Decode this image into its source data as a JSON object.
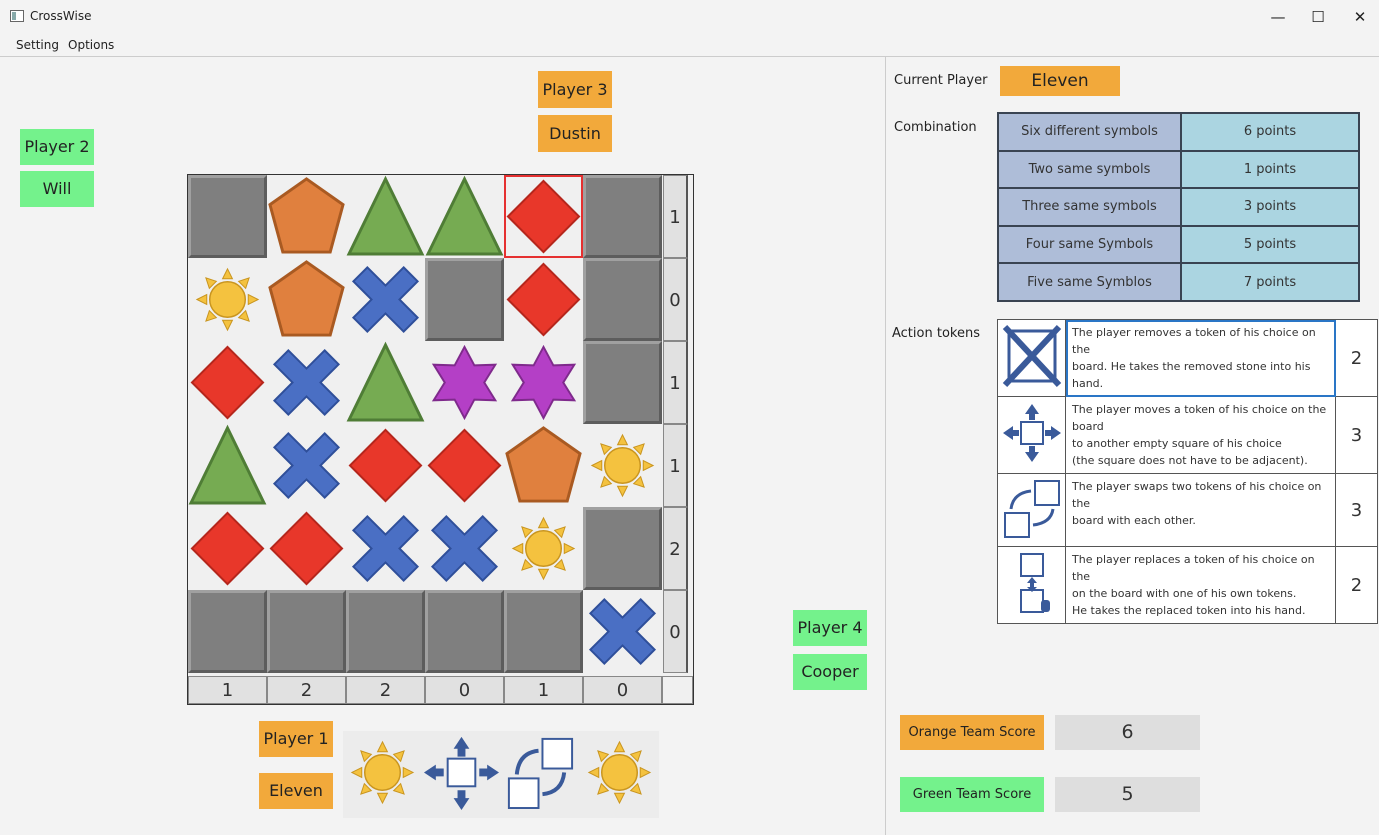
{
  "window": {
    "title": "CrossWise",
    "minimize": "—",
    "maximize": "☐",
    "close": "✕"
  },
  "menu": {
    "setting": "Setting",
    "options": "Options"
  },
  "players": {
    "p1": {
      "label": "Player 1",
      "name": "Eleven"
    },
    "p2": {
      "label": "Player 2",
      "name": "Will"
    },
    "p3": {
      "label": "Player 3",
      "name": "Dustin"
    },
    "p4": {
      "label": "Player 4",
      "name": "Cooper"
    }
  },
  "board": {
    "grid": [
      [
        "empty",
        "pentagon",
        "triangle",
        "triangle",
        "diamond",
        "empty"
      ],
      [
        "sun",
        "pentagon",
        "cross",
        "empty",
        "diamond",
        "empty"
      ],
      [
        "diamond",
        "cross",
        "triangle",
        "star",
        "star",
        "empty"
      ],
      [
        "triangle",
        "cross",
        "diamond",
        "diamond",
        "pentagon",
        "sun"
      ],
      [
        "diamond",
        "diamond",
        "cross",
        "cross",
        "sun",
        "empty"
      ],
      [
        "empty",
        "empty",
        "empty",
        "empty",
        "empty",
        "cross"
      ]
    ],
    "selected": {
      "row": 0,
      "col": 4
    },
    "row_sums": [
      "1",
      "0",
      "1",
      "1",
      "2",
      "0"
    ],
    "col_sums": [
      "1",
      "2",
      "2",
      "0",
      "1",
      "0"
    ]
  },
  "hand": [
    "sun",
    "move",
    "swap",
    "sun"
  ],
  "current_player": {
    "label": "Current Player",
    "value": "Eleven"
  },
  "combination": {
    "label": "Combination",
    "rows": [
      [
        "Six different symbols",
        "6 points"
      ],
      [
        "Two same symbols",
        "1 points"
      ],
      [
        "Three same symbols",
        "3 points"
      ],
      [
        "Four same Symbols",
        "5 points"
      ],
      [
        "Five same Symblos",
        "7 points"
      ]
    ]
  },
  "action_tokens": {
    "label": "Action tokens",
    "rows": [
      {
        "icon": "remove-icon",
        "desc": "The player removes a token of his choice on the\nboard.  He takes the removed stone into his hand.",
        "count": "2"
      },
      {
        "icon": "move-icon",
        "desc": "The player moves a token of his choice on the board\n to another empty square of his choice\n(the square does not have to be adjacent).",
        "count": "3"
      },
      {
        "icon": "swap-icon",
        "desc": "The player swaps two tokens of his choice on the\nboard  with each other.",
        "count": "3"
      },
      {
        "icon": "replace-icon",
        "desc": "The player replaces a token of his choice on the\n on the board with one of his own tokens.\nHe takes the replaced token into his hand.",
        "count": "2"
      }
    ]
  },
  "scores": {
    "orange": {
      "label": "Orange Team Score",
      "value": "6"
    },
    "green": {
      "label": "Green Team Score",
      "value": "5"
    }
  },
  "colors": {
    "orange_team": "#f2a93b",
    "green_team": "#74f28c",
    "selection": "#e53030",
    "diamond": "#e8372a",
    "cross": "#4a6fc4",
    "triangle": "#76ab52",
    "pentagon": "#e0803e",
    "star": "#b43fc6",
    "sun": "#f4c23f"
  }
}
